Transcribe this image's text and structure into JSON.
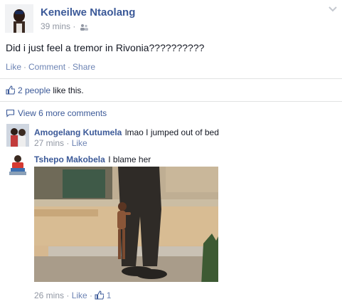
{
  "post": {
    "author": "Keneilwe Ntaolang",
    "time": "39 mins",
    "audience_icon": "friends-icon",
    "status": "Did i just feel a tremor in Rivonia??????????",
    "actions": {
      "like": "Like",
      "comment": "Comment",
      "share": "Share"
    },
    "likes_count": "2 people",
    "likes_suffix": " like this."
  },
  "comments_toggle": "View 6 more comments",
  "comments": [
    {
      "author": "Amogelang Kutumela",
      "text": "lmao I jumped out of bed",
      "time": "27 mins",
      "like": "Like"
    },
    {
      "author": "Tshepo Makobela",
      "text": "I blame her",
      "time": "26 mins",
      "like": "Like",
      "like_count": "1"
    }
  ],
  "colors": {
    "link": "#3b5998",
    "meta": "#9197a3",
    "divider": "#e1e2e3",
    "action": "#6d84b4"
  }
}
